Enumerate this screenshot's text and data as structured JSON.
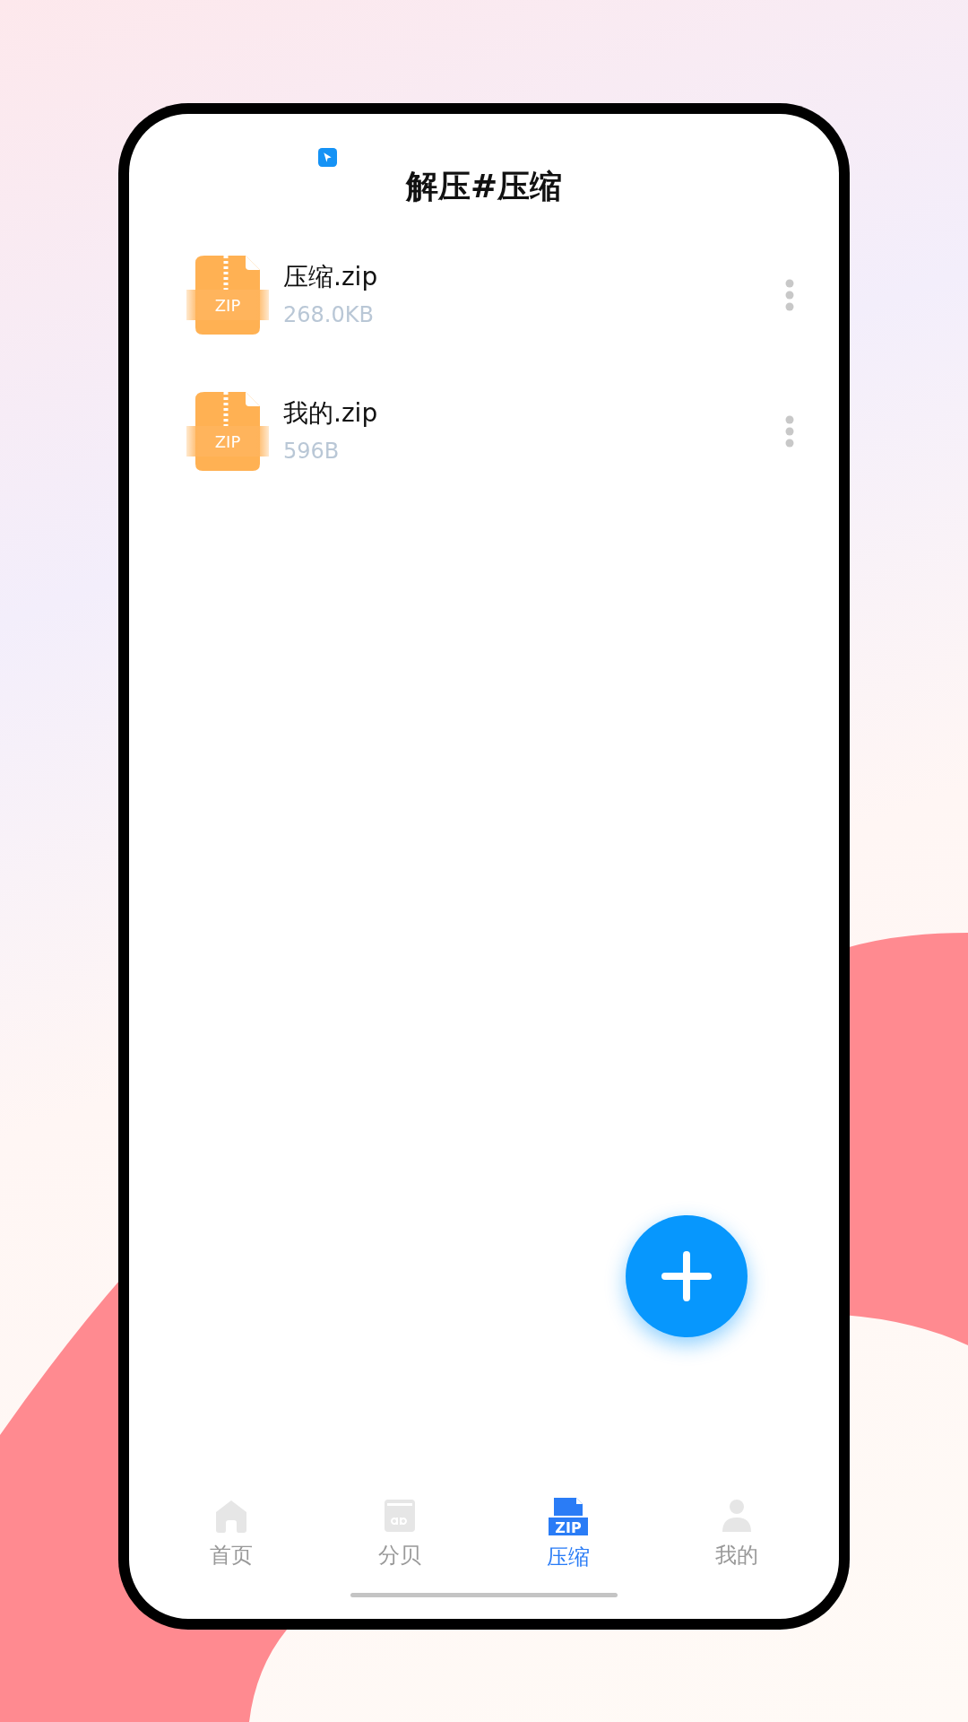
{
  "header": {
    "title": "解压#压缩"
  },
  "files": [
    {
      "name": "压缩.zip",
      "size": "268.0KB",
      "icon_label": "ZIP"
    },
    {
      "name": "我的.zip",
      "size": "596B",
      "icon_label": "ZIP"
    }
  ],
  "tabs": [
    {
      "label": "首页",
      "selected": false
    },
    {
      "label": "分贝",
      "selected": false
    },
    {
      "label": "压缩",
      "selected": true,
      "icon_label": "ZIP"
    },
    {
      "label": "我的",
      "selected": false
    }
  ]
}
